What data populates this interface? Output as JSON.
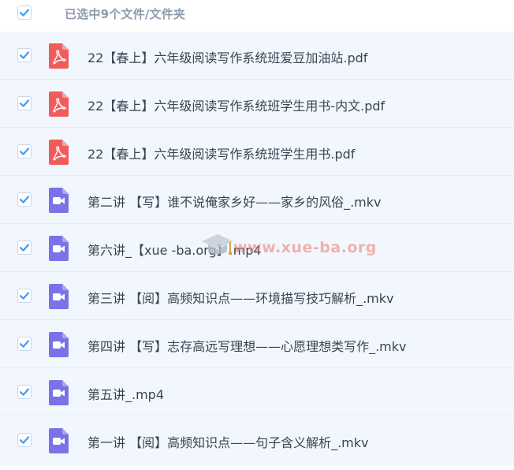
{
  "header": {
    "label": "已选中9个文件/文件夹",
    "checked": true
  },
  "colors": {
    "pdf_icon": "#f25b5b",
    "video_icon": "#7b72e9",
    "checkmark": "#3a9ef5",
    "row_bg": "#f2f7fd",
    "watermark": "#ec7866"
  },
  "files": [
    {
      "name": "22【春上】六年级阅读写作系统班爱豆加油站.pdf",
      "type": "pdf",
      "icon": "pdf-file-icon",
      "checked": true
    },
    {
      "name": "22【春上】六年级阅读写作系统班学生用书-内文.pdf",
      "type": "pdf",
      "icon": "pdf-file-icon",
      "checked": true
    },
    {
      "name": "22【春上】六年级阅读写作系统班学生用书.pdf",
      "type": "pdf",
      "icon": "pdf-file-icon",
      "checked": true
    },
    {
      "name": "第二讲 【写】谁不说俺家乡好——家乡的风俗_.mkv",
      "type": "video",
      "icon": "video-file-icon",
      "checked": true
    },
    {
      "name": "第六讲_【xue -ba.org】.mp4",
      "type": "video",
      "icon": "video-file-icon",
      "checked": true
    },
    {
      "name": "第三讲 【阅】高频知识点——环境描写技巧解析_.mkv",
      "type": "video",
      "icon": "video-file-icon",
      "checked": true
    },
    {
      "name": "第四讲 【写】志存高远写理想——心愿理想类写作_.mkv",
      "type": "video",
      "icon": "video-file-icon",
      "checked": true
    },
    {
      "name": "第五讲_.mp4",
      "type": "video",
      "icon": "video-file-icon",
      "checked": true
    },
    {
      "name": "第一讲 【阅】高频知识点——句子含义解析_.mkv",
      "type": "video",
      "icon": "video-file-icon",
      "checked": true
    }
  ],
  "watermark": {
    "text": "www.xue-ba.org"
  }
}
